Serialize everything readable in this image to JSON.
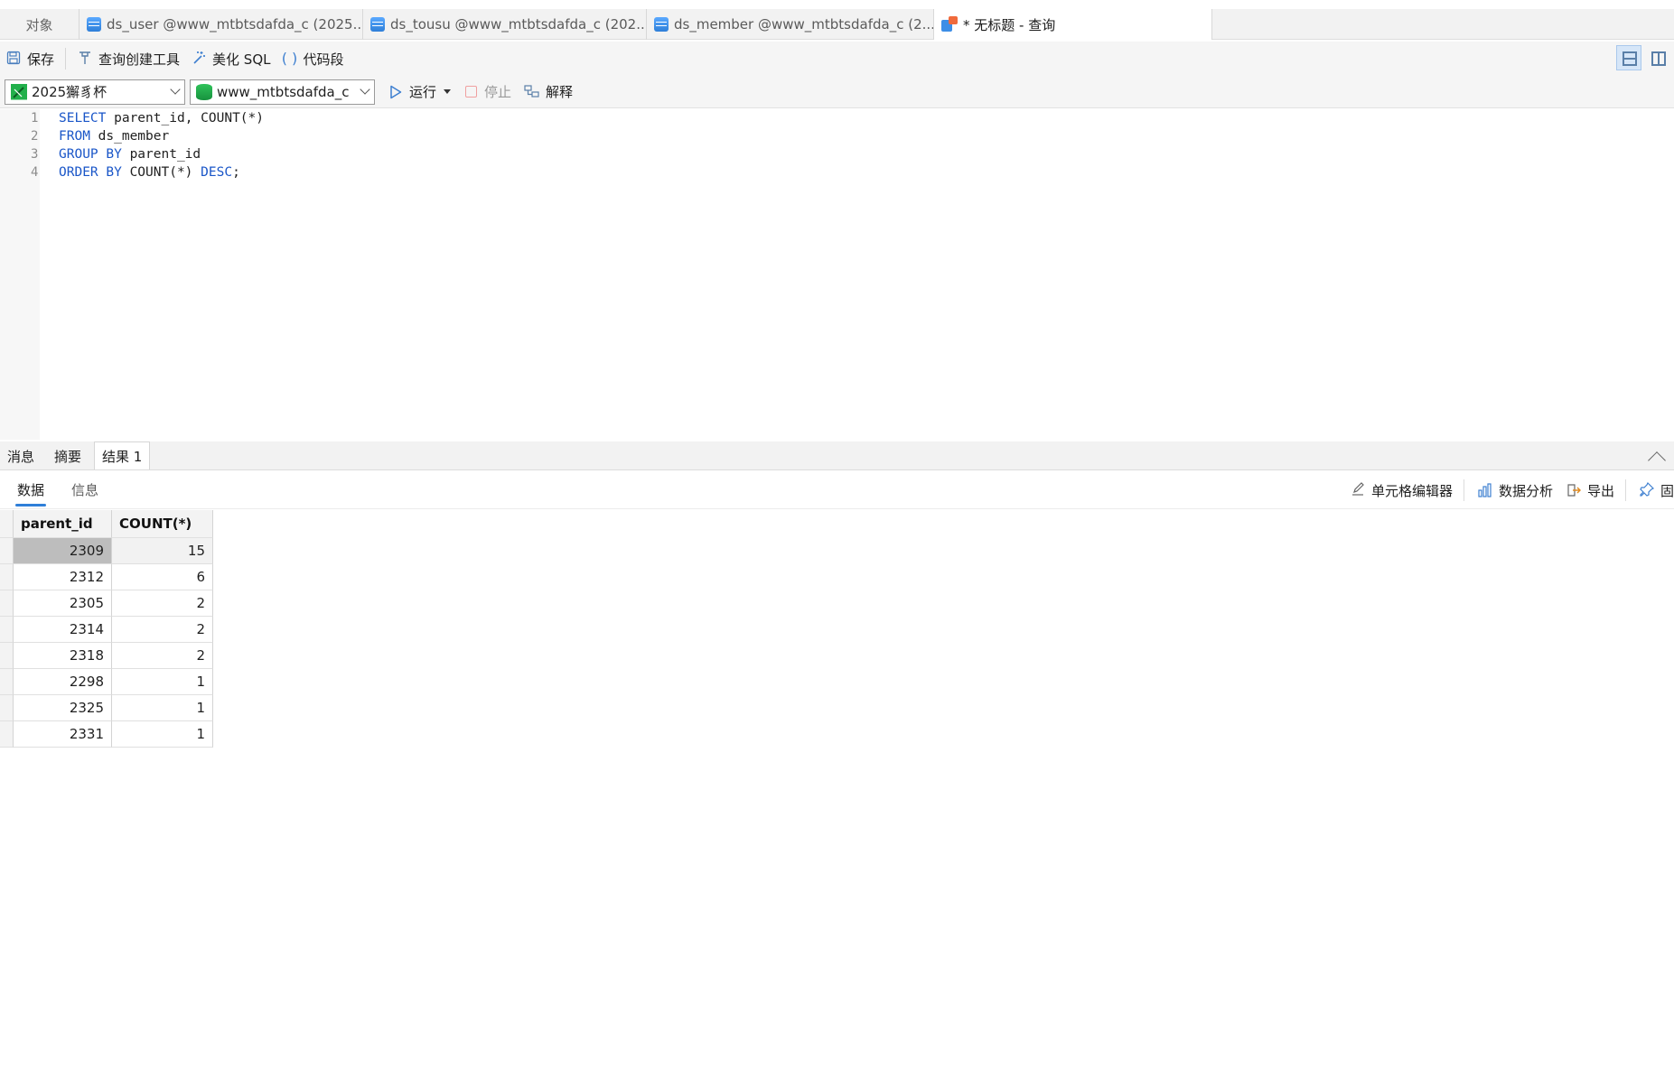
{
  "tabs": {
    "objects_label": "对象",
    "items": [
      {
        "label": "ds_user @www_mtbtsdafda_c (2025..."
      },
      {
        "label": "ds_tousu @www_mtbtsdafda_c (202..."
      },
      {
        "label": "ds_member @www_mtbtsdafda_c (2..."
      },
      {
        "label": "* 无标题 - 查询"
      }
    ]
  },
  "toolbar": {
    "save": "保存",
    "query_builder": "查询创建工具",
    "beautify": "美化 SQL",
    "snippet": "代码段"
  },
  "connection": {
    "name": "2025獬豸杯",
    "database": "www_mtbtsdafda_c",
    "run": "运行",
    "stop": "停止",
    "explain": "解释"
  },
  "editor": {
    "lines": [
      {
        "n": "1",
        "kw1": "SELECT",
        "rest": " parent_id, COUNT(*)"
      },
      {
        "n": "2",
        "kw1": "FROM",
        "rest": " ds_member"
      },
      {
        "n": "3",
        "kw1": "GROUP BY",
        "rest": " parent_id"
      },
      {
        "n": "4",
        "kw1": "ORDER BY",
        "rest": " COUNT(*) ",
        "kw2": "DESC",
        "tail": ";"
      }
    ]
  },
  "result_tabs": {
    "message": "消息",
    "summary": "摘要",
    "result1": "结果 1"
  },
  "subbar": {
    "data": "数据",
    "info": "信息",
    "cell_editor": "单元格编辑器",
    "data_analysis": "数据分析",
    "export": "导出",
    "pin": "固"
  },
  "grid": {
    "columns": [
      "parent_id",
      "COUNT(*)"
    ],
    "rows": [
      [
        "2309",
        "15"
      ],
      [
        "2312",
        "6"
      ],
      [
        "2305",
        "2"
      ],
      [
        "2314",
        "2"
      ],
      [
        "2318",
        "2"
      ],
      [
        "2298",
        "1"
      ],
      [
        "2325",
        "1"
      ],
      [
        "2331",
        "1"
      ]
    ]
  }
}
